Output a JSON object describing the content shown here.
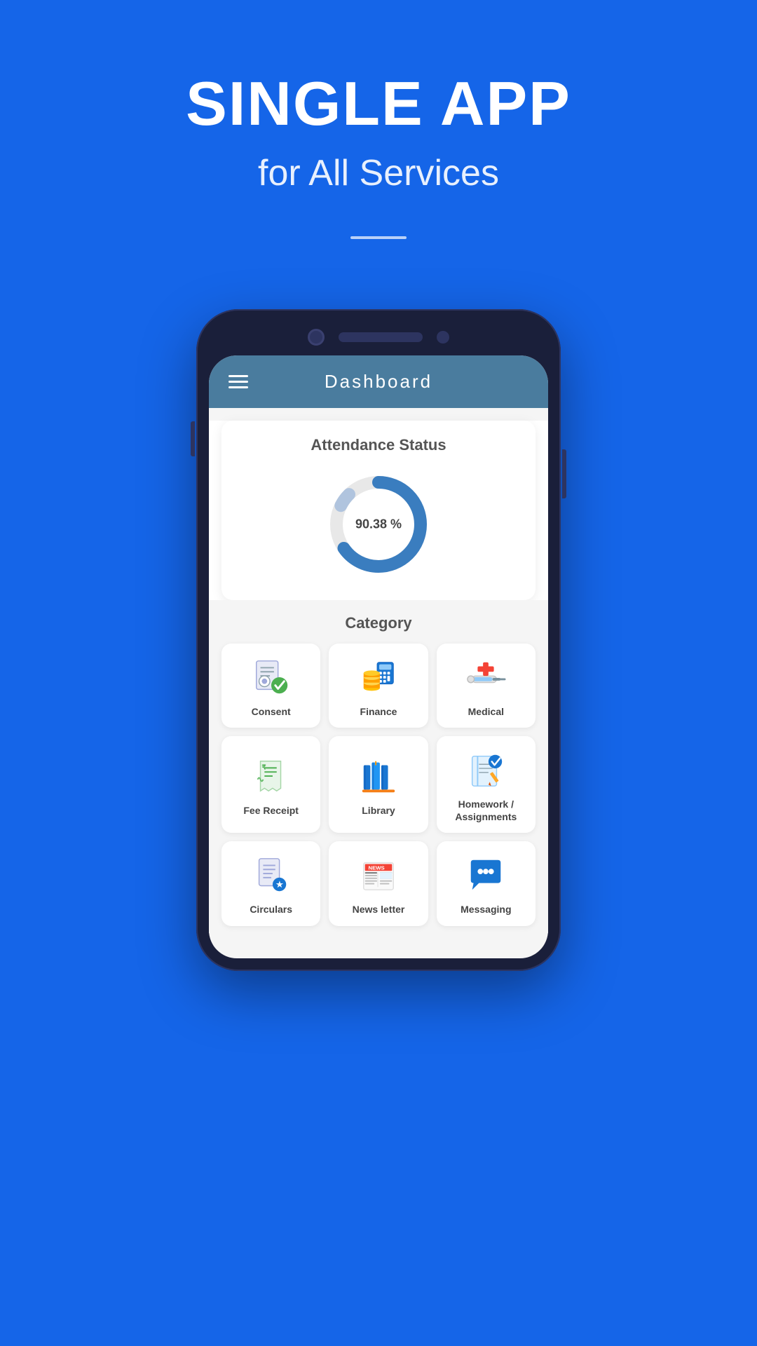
{
  "hero": {
    "title": "SINGLE APP",
    "subtitle": "for All Services"
  },
  "phone": {
    "screen": {
      "header": {
        "title": "Dashboard",
        "menu_label": "Menu"
      },
      "attendance": {
        "title": "Attendance Status",
        "percentage": "90.38 %",
        "value": 90.38
      },
      "category": {
        "title": "Category",
        "items": [
          {
            "id": "consent",
            "label": "Consent",
            "icon": "consent"
          },
          {
            "id": "finance",
            "label": "Finance",
            "icon": "finance"
          },
          {
            "id": "medical",
            "label": "Medical",
            "icon": "medical"
          },
          {
            "id": "fee-receipt",
            "label": "Fee Receipt",
            "icon": "fee-receipt"
          },
          {
            "id": "library",
            "label": "Library",
            "icon": "library"
          },
          {
            "id": "homework",
            "label": "Homework /\nAssignments",
            "icon": "homework"
          },
          {
            "id": "circulars",
            "label": "Circulars",
            "icon": "circulars"
          },
          {
            "id": "newsletter",
            "label": "News letter",
            "icon": "newsletter"
          },
          {
            "id": "messaging",
            "label": "Messaging",
            "icon": "messaging"
          }
        ]
      }
    }
  }
}
